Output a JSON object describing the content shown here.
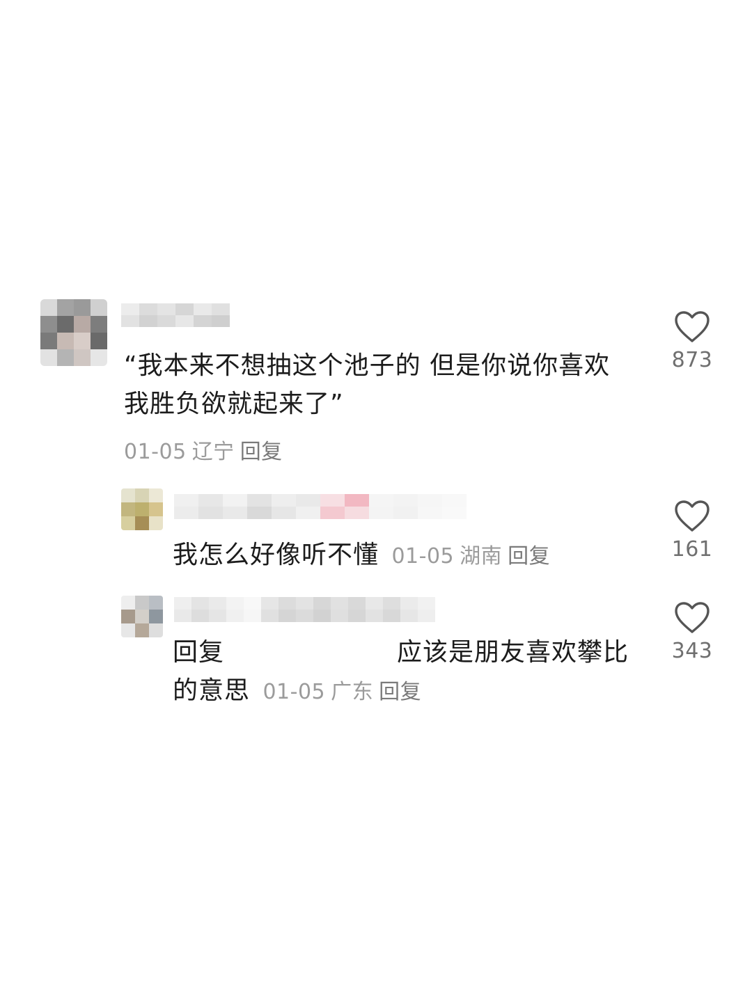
{
  "comments": [
    {
      "text": "“我本来不想抽这个池子的 但是你说你喜欢 我胜负欲就起来了”",
      "date": "01-05",
      "region": "辽宁",
      "reply_label": "回复",
      "likes": "873"
    },
    {
      "text": "我怎么好像听不懂",
      "date": "01-05",
      "region": "湖南",
      "reply_label": "回复",
      "likes": "161"
    },
    {
      "reply_prefix": "回复",
      "text": "应该是朋友喜欢攀比的意思",
      "date": "01-05",
      "region": "广东",
      "reply_label": "回复",
      "likes": "343"
    }
  ],
  "icons": {
    "like": "heart-outline-icon"
  },
  "colors": {
    "text": "#1c1c1c",
    "meta": "#9b9b9b",
    "count": "#6f6f6f",
    "heart": "#555555"
  }
}
